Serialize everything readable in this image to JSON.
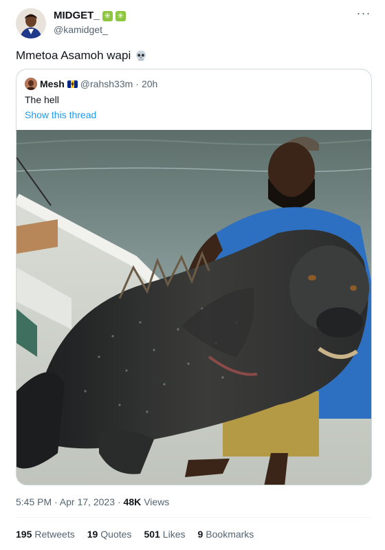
{
  "author": {
    "display_name": "MIDGET_",
    "badge_icons": [
      "sparkle-emoji-icon",
      "sparkle-emoji-icon"
    ],
    "handle": "@kamidget_"
  },
  "tweet": {
    "text": "Mmetoa Asamoh wapi",
    "emoji_icon": "skull-icon"
  },
  "quote": {
    "display_name": "Mesh",
    "flag_icon": "barbados-flag-icon",
    "handle": "@rahsh33m",
    "separator": "·",
    "time": "20h",
    "text": "The hell",
    "thread_link": "Show this thread",
    "image_icon": "photo-man-holding-large-fish"
  },
  "meta": {
    "time": "5:45 PM · Apr 17, 2023 ·",
    "views_count": "48K",
    "views_label": "Views"
  },
  "stats": [
    {
      "count": "195",
      "label": "Retweets"
    },
    {
      "count": "19",
      "label": "Quotes"
    },
    {
      "count": "501",
      "label": "Likes"
    },
    {
      "count": "9",
      "label": "Bookmarks"
    }
  ],
  "colors": {
    "link": "#1d9bf0",
    "secondary_text": "#536471",
    "border": "#cfd9de",
    "badge_green": "#8cc63f"
  }
}
